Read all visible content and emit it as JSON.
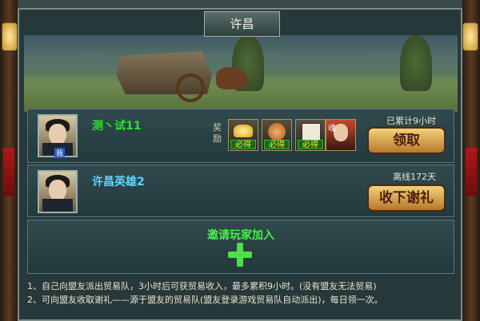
{
  "window": {
    "title": "许昌"
  },
  "rows": [
    {
      "name": "测丶试11",
      "self_tag": "我",
      "reward_label": "奖励",
      "rewards": [
        {
          "icon": "gold-ingot-icon",
          "tag": "必得"
        },
        {
          "icon": "copper-coin-icon",
          "tag": "必得"
        },
        {
          "icon": "experience-book-icon",
          "tag": "必得"
        },
        {
          "icon": "hero-soul-icon",
          "tag": "魂"
        }
      ],
      "status": "已累计9小时",
      "button": "领取"
    },
    {
      "name": "许昌英雄2",
      "status": "离线172天",
      "button": "收下谢礼"
    }
  ],
  "invite": {
    "label": "邀请玩家加入"
  },
  "notes": [
    "1、自己向盟友派出贸易队，3小时后可获贸易收入，最多累积9小时。(没有盟友无法贸易)",
    "2、可向盟友收取谢礼——源于盟友的贸易队(盟友登录游戏贸易队自动派出)，每日领一次。"
  ],
  "colors": {
    "accent_green": "#48ef4a",
    "name_cyan": "#5ed7ff",
    "button_gold": "#f3d27a"
  }
}
